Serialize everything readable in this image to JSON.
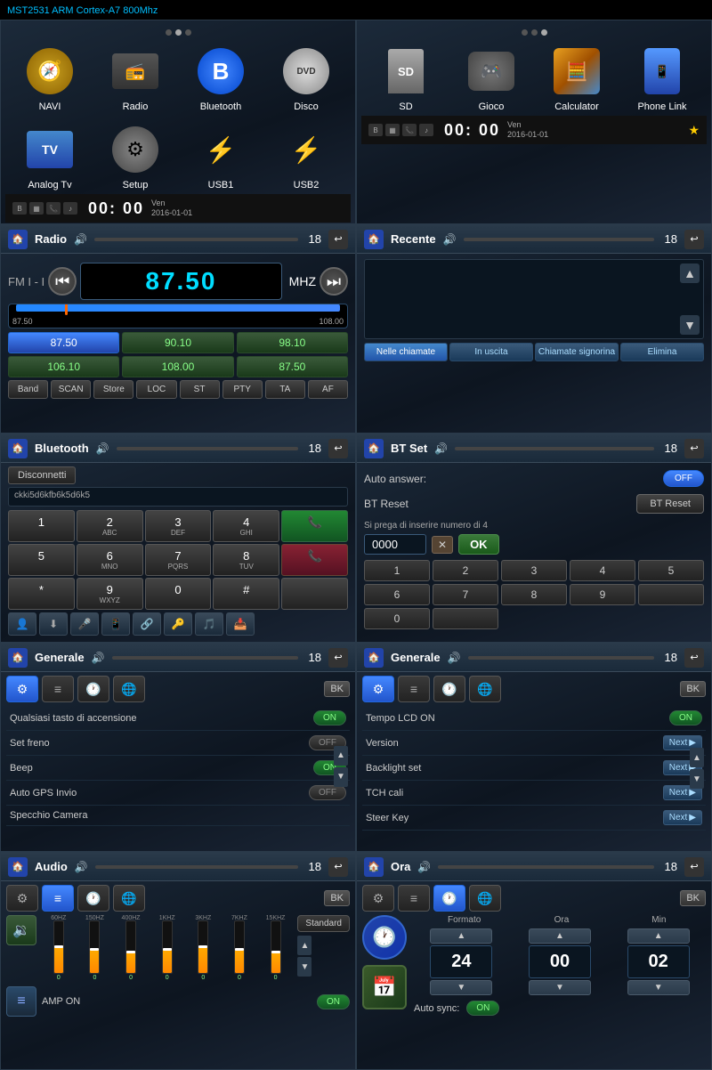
{
  "title_label": "MST2531 ARM Cortex-A7 800Mhz",
  "row1": {
    "left": {
      "dots": [
        false,
        true,
        false
      ],
      "apps": [
        {
          "label": "NAVI",
          "icon": "navi"
        },
        {
          "label": "Radio",
          "icon": "radio"
        },
        {
          "label": "Bluetooth",
          "icon": "bluetooth"
        },
        {
          "label": "Disco",
          "icon": "dvd"
        },
        {
          "label": "Analog Tv",
          "icon": "tv"
        },
        {
          "label": "Setup",
          "icon": "setup"
        },
        {
          "label": "USB1",
          "icon": "usb"
        },
        {
          "label": "USB2",
          "icon": "usb"
        }
      ],
      "status_time": "00: 00",
      "status_day": "Ven",
      "status_date": "2016-01-01"
    },
    "right": {
      "dots": [
        false,
        false,
        true
      ],
      "apps": [
        {
          "label": "SD",
          "icon": "sd"
        },
        {
          "label": "Gioco",
          "icon": "game"
        },
        {
          "label": "Calculator",
          "icon": "calc"
        },
        {
          "label": "Phone Link",
          "icon": "phone"
        }
      ],
      "status_time": "00: 00",
      "status_day": "Ven",
      "status_date": "2016-01-01"
    }
  },
  "row2": {
    "radio": {
      "title": "Radio",
      "volume": "18",
      "band": "FM I - I",
      "freq": "87.50",
      "unit": "MHZ",
      "range_min": "87.50",
      "range_max": "108.00",
      "presets": [
        "87.50",
        "90.10",
        "98.10",
        "106.10",
        "108.00",
        "87.50"
      ],
      "controls": [
        "Band",
        "SCAN",
        "Store",
        "LOC",
        "ST",
        "PTY",
        "TA",
        "AF"
      ]
    },
    "recente": {
      "title": "Recente",
      "volume": "18",
      "tabs": [
        "Nelle chiamate",
        "In uscita",
        "Chiamate signorina",
        "Elimina"
      ]
    }
  },
  "row3": {
    "bluetooth": {
      "title": "Bluetooth",
      "volume": "18",
      "disconnect_label": "Disconnetti",
      "device_id": "ckki5d6kfb6k5d6k5",
      "keypad": [
        "1",
        "2",
        "3",
        "4",
        "",
        "",
        "5",
        "ABC",
        "DEF",
        "GHI",
        "",
        "",
        "6",
        "7",
        "8",
        "9",
        "0",
        "#"
      ],
      "keys_row1": [
        "1",
        "2",
        "3",
        "4",
        ""
      ],
      "keys_row2": [
        "6",
        "7",
        "8",
        "9",
        "0"
      ],
      "keys_labels": [
        "ABC",
        "DEF",
        "GHI",
        "",
        "#"
      ]
    },
    "btset": {
      "title": "BT Set",
      "volume": "18",
      "auto_answer_label": "Auto answer:",
      "auto_answer_val": "OFF",
      "bt_reset_label": "BT Reset",
      "bt_reset_btn": "BT Reset",
      "pin_note": "Si prega di inserire numero di 4",
      "pin_val": "0000",
      "ok_btn": "OK",
      "numpad": [
        "1",
        "2",
        "3",
        "4",
        "5",
        "6",
        "7",
        "8",
        "9",
        "",
        "0",
        ""
      ]
    }
  },
  "row4": {
    "generale_left": {
      "title": "Generale",
      "volume": "18",
      "tabs": [
        "⚙",
        "≡",
        "🕐",
        "🌐",
        "BK"
      ],
      "settings": [
        {
          "label": "Qualsiasi tasto di accensione",
          "val": "ON",
          "type": "on"
        },
        {
          "label": "Set freno",
          "val": "OFF",
          "type": "off"
        },
        {
          "label": "Beep",
          "val": "ON",
          "type": "on"
        },
        {
          "label": "Auto GPS Invio",
          "val": "OFF",
          "type": "off"
        },
        {
          "label": "Specchio Camera",
          "val": "",
          "type": "empty"
        }
      ]
    },
    "generale_right": {
      "title": "Generale",
      "volume": "18",
      "settings": [
        {
          "label": "Tempo LCD ON",
          "val": "ON",
          "type": "on"
        },
        {
          "label": "Version",
          "val": "Next",
          "type": "next"
        },
        {
          "label": "Backlight set",
          "val": "Next",
          "type": "next"
        },
        {
          "label": "TCH cali",
          "val": "Next",
          "type": "next"
        },
        {
          "label": "Steer Key",
          "val": "Next",
          "type": "next"
        }
      ]
    }
  },
  "row5": {
    "audio": {
      "title": "Audio",
      "volume": "18",
      "bands": [
        "60HZ",
        "150HZ",
        "400HZ",
        "1KHZ",
        "3KHZ",
        "7KHZ",
        "15KHZ"
      ],
      "band_vals": [
        0,
        0,
        0,
        0,
        0,
        0,
        0
      ],
      "band_heights": [
        50,
        45,
        40,
        45,
        50,
        45,
        40
      ],
      "preset_label": "Standard",
      "amp_label": "AMP ON",
      "amp_val": "ON"
    },
    "ora": {
      "title": "Ora",
      "volume": "18",
      "col_labels": [
        "Formato",
        "Ora",
        "Min"
      ],
      "formato_val": "24",
      "ora_val": "00",
      "min_val": "02",
      "autosync_label": "Auto sync:",
      "autosync_val": "ON"
    }
  }
}
